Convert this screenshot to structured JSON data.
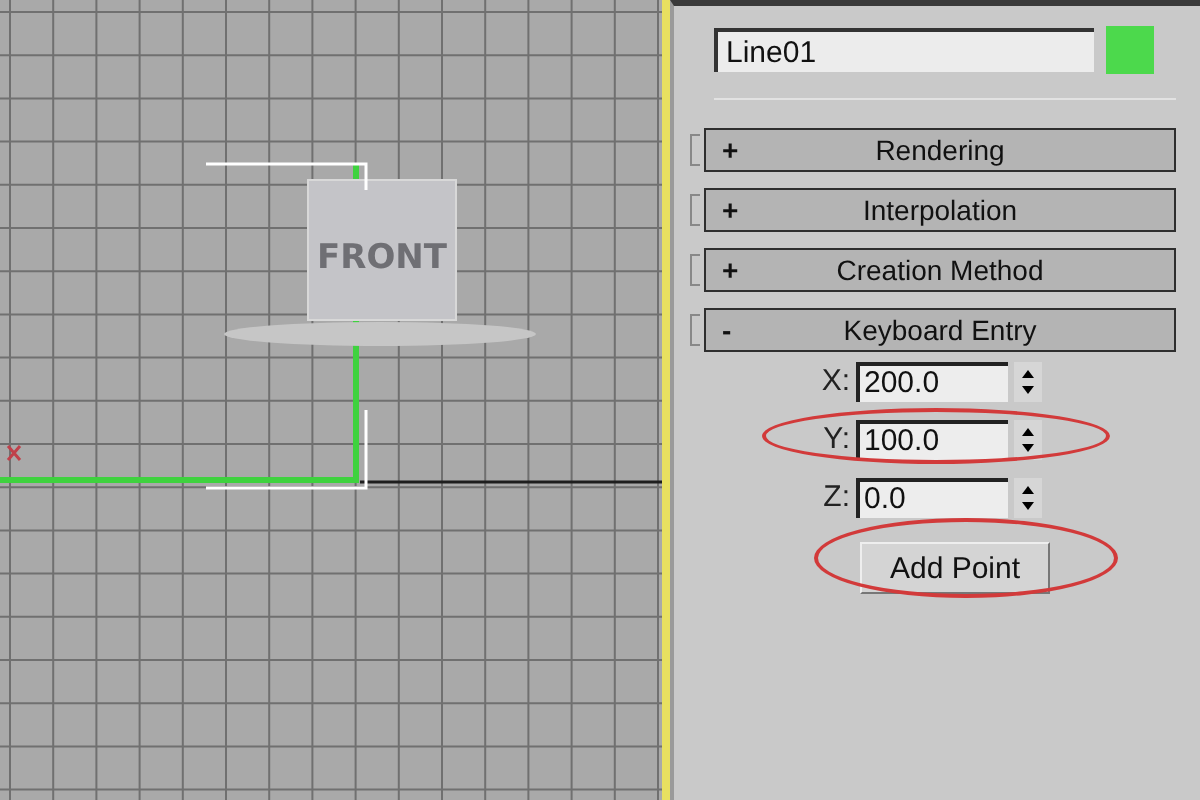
{
  "viewport": {
    "viewcube_label": "FRONT"
  },
  "object": {
    "name": "Line01",
    "color": "#4cd94c"
  },
  "rollouts": [
    {
      "sign": "+",
      "title": "Rendering"
    },
    {
      "sign": "+",
      "title": "Interpolation"
    },
    {
      "sign": "+",
      "title": "Creation Method"
    },
    {
      "sign": "-",
      "title": "Keyboard Entry"
    }
  ],
  "coordinates": [
    {
      "label": "X:",
      "value": "200.0",
      "circled": false
    },
    {
      "label": "Y:",
      "value": "100.0",
      "circled": true
    },
    {
      "label": "Z:",
      "value": "0.0",
      "circled": false
    }
  ],
  "add_point_button": {
    "label": "Add Point",
    "circled": true
  }
}
